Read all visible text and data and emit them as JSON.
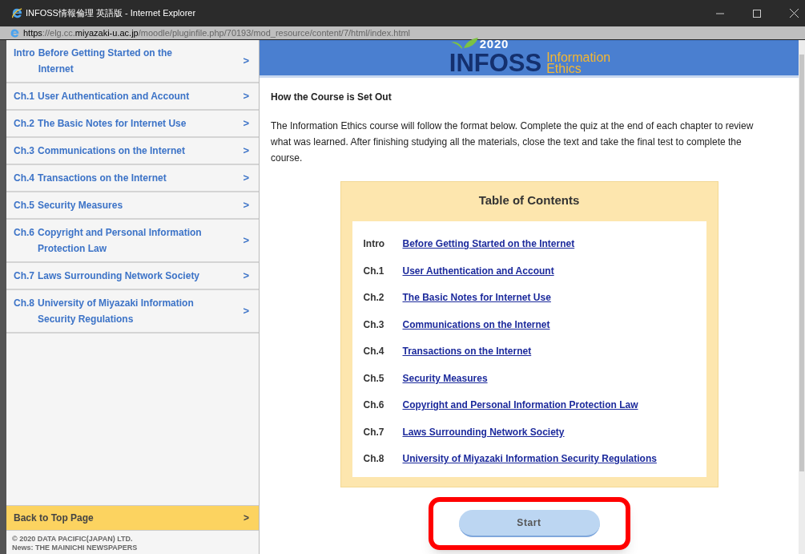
{
  "window": {
    "title": "INFOSS情報倫理 英語版 - Internet Explorer"
  },
  "address_bar": {
    "segments": [
      {
        "text": "https",
        "emphasis": true
      },
      {
        "text": "://elg.cc.",
        "emphasis": false
      },
      {
        "text": "miyazaki-u.ac.jp",
        "emphasis": true
      },
      {
        "text": "/moodle/pluginfile.php/70193/mod_resource/content/7/html/index.html",
        "emphasis": false
      }
    ]
  },
  "sidebar": {
    "items": [
      {
        "number": "Intro",
        "title": "Before Getting Started on the Internet",
        "chevron": ">"
      },
      {
        "number": "Ch.1",
        "title": "User Authentication and Account",
        "chevron": ">"
      },
      {
        "number": "Ch.2",
        "title": "The Basic Notes for Internet Use",
        "chevron": ">"
      },
      {
        "number": "Ch.3",
        "title": "Communications on the Internet",
        "chevron": ">"
      },
      {
        "number": "Ch.4",
        "title": "Transactions on the Internet",
        "chevron": ">"
      },
      {
        "number": "Ch.5",
        "title": "Security Measures",
        "chevron": ">"
      },
      {
        "number": "Ch.6",
        "title": "Copyright and Personal Information Protection Law",
        "chevron": ">"
      },
      {
        "number": "Ch.7",
        "title": "Laws Surrounding Network Society",
        "chevron": ">"
      },
      {
        "number": "Ch.8",
        "title": "University of Miyazaki Information Security Regulations",
        "chevron": ">"
      }
    ],
    "back_link": {
      "label": "Back to Top Page",
      "chevron": ">"
    },
    "footer": [
      "© 2020 DATA PACIFIC(JAPAN) LTD.",
      "News: THE MAINICHI NEWSPAPERS"
    ]
  },
  "header": {
    "logo": {
      "year": "2020",
      "name": "INFOSS",
      "subtitle_1": "Information",
      "subtitle_2": "Ethics"
    }
  },
  "content": {
    "heading": "How the Course is Set Out",
    "intro": "The Information Ethics course will follow the format below. Complete the quiz at the end of each chapter to review what was learned. After finishing studying all the materials, close the text and take the final test to complete the course.",
    "toc": {
      "title": "Table of Contents",
      "rows": [
        {
          "number": "Intro",
          "link": "Before Getting Started on the Internet"
        },
        {
          "number": "Ch.1",
          "link": "User Authentication and Account"
        },
        {
          "number": "Ch.2",
          "link": "The Basic Notes for Internet Use"
        },
        {
          "number": "Ch.3",
          "link": "Communications on the Internet"
        },
        {
          "number": "Ch.4",
          "link": "Transactions on the Internet"
        },
        {
          "number": "Ch.5",
          "link": "Security Measures"
        },
        {
          "number": "Ch.6",
          "link": "Copyright and Personal Information Protection Law"
        },
        {
          "number": "Ch.7",
          "link": "Laws Surrounding Network Society"
        },
        {
          "number": "Ch.8",
          "link": "University of Miyazaki Information Security Regulations"
        }
      ]
    },
    "start_button": {
      "label": "Start",
      "highlighted": true
    }
  }
}
